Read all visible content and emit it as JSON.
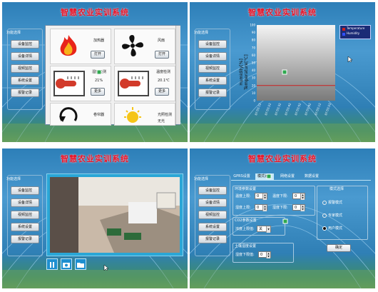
{
  "app_title": "智慧农业实训系统",
  "sidebar": {
    "group_title": "功能选择",
    "items": [
      "设备监控",
      "设备详情",
      "视频监控",
      "系统设置",
      "报警记录"
    ]
  },
  "monitor": {
    "cards": [
      {
        "label": "加热器",
        "value": "",
        "button": "打开",
        "icon": "flame-icon"
      },
      {
        "label": "风扇",
        "value": "",
        "button": "打开",
        "icon": "fan-icon"
      },
      {
        "label": "湿度检测",
        "value": "21%",
        "button": "更多",
        "icon": "thermometer-icon"
      },
      {
        "label": "温度检测",
        "value": "20.1℃",
        "button": "更多",
        "icon": "thermometer-icon"
      },
      {
        "label": "卷帘器",
        "value": "",
        "button": "",
        "icon": "rotate-icon"
      },
      {
        "label": "光照检测",
        "value": "无光",
        "button": "",
        "icon": "sun-icon"
      }
    ]
  },
  "chart_panel": {
    "legend_temperature": "Temperature",
    "legend_humidity": "Humidity",
    "y_axis_label": "Humidity[%]\nTemperature[℃]"
  },
  "chart_data": {
    "type": "line",
    "title": "",
    "ylabel": "Humidity[%] Temperature[℃]",
    "ylim": [
      0,
      100
    ],
    "y_ticks": [
      "100",
      "90",
      "80",
      "70",
      "60",
      "50",
      "40",
      "30",
      "20",
      "10",
      "0"
    ],
    "x_ticks": [
      "07:53:12",
      "07:53:22",
      "07:53:32",
      "07:53:42",
      "07:53:52",
      "07:53:02",
      "07:53:12",
      "07:53:22"
    ],
    "series": [
      {
        "name": "Temperature",
        "color": "#cc2020",
        "values": [
          20.1,
          20.1,
          20.1,
          20.1,
          20.1,
          20.1,
          20.1,
          20.1
        ]
      },
      {
        "name": "Humidity",
        "color": "#3050ff",
        "values": []
      }
    ],
    "legend": "top-right",
    "grid": false
  },
  "video": {
    "controls": [
      "pause-icon",
      "camera-icon",
      "folder-icon"
    ]
  },
  "settings": {
    "tabs": [
      "GPRS设置",
      "模式设置",
      "网络设置",
      "数据设置"
    ],
    "env_group": "环境参数设置",
    "temp_upper": "温度上限:",
    "temp_lower": "温度下限:",
    "hum_upper": "湿度上限:",
    "hum_lower": "湿度下限:",
    "temp_upper_val": "0",
    "temp_lower_val": "0",
    "hum_upper_val": "0",
    "hum_lower_val": "0",
    "co2_group": "CO2参数设置",
    "co2_label": "浓度上限值:",
    "co2_value": "关",
    "soil_group": "土壤湿度设置",
    "soil_label": "湿度下限值:",
    "soil_value": "0",
    "mode_group": "模式选择",
    "modes": [
      "报警模式",
      "专家模式",
      "用户模式"
    ],
    "confirm": "确定"
  }
}
